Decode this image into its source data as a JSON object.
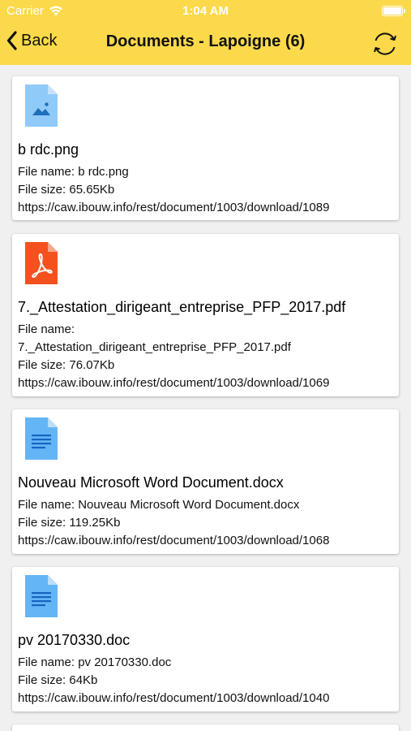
{
  "status_bar": {
    "carrier": "Carrier",
    "time": "1:04 AM"
  },
  "nav": {
    "back_label": "Back",
    "title": "Documents - Lapoigne (6)"
  },
  "labels": {
    "file_name": "File name:",
    "file_size": "File size:"
  },
  "documents": [
    {
      "icon": "image-file-icon",
      "title": "b rdc.png",
      "file_name_line": "File name: b rdc.png",
      "file_size_line": "File size: 65.65Kb",
      "url": "https://caw.ibouw.info/rest/document/1003/download/1089"
    },
    {
      "icon": "pdf-file-icon",
      "title": "7._Attestation_dirigeant_entreprise_PFP_2017.pdf",
      "file_name_line": "File name:",
      "file_name_line2": "7._Attestation_dirigeant_entreprise_PFP_2017.pdf",
      "file_size_line": "File size: 76.07Kb",
      "url": "https://caw.ibouw.info/rest/document/1003/download/1069"
    },
    {
      "icon": "word-file-icon",
      "title": "Nouveau Microsoft Word Document.docx",
      "file_name_line": "File name: Nouveau Microsoft Word Document.docx",
      "file_size_line": "File size: 119.25Kb",
      "url": "https://caw.ibouw.info/rest/document/1003/download/1068"
    },
    {
      "icon": "word-file-icon",
      "title": "pv 20170330.doc",
      "file_name_line": "File name: pv 20170330.doc",
      "file_size_line": "File size: 64Kb",
      "url": "https://caw.ibouw.info/rest/document/1003/download/1040"
    }
  ],
  "colors": {
    "nav_background": "#fbd94a",
    "list_background": "#f0f0f0",
    "image_icon": "#90caf9",
    "pdf_icon": "#f4511e",
    "doc_icon": "#64b5f6"
  }
}
